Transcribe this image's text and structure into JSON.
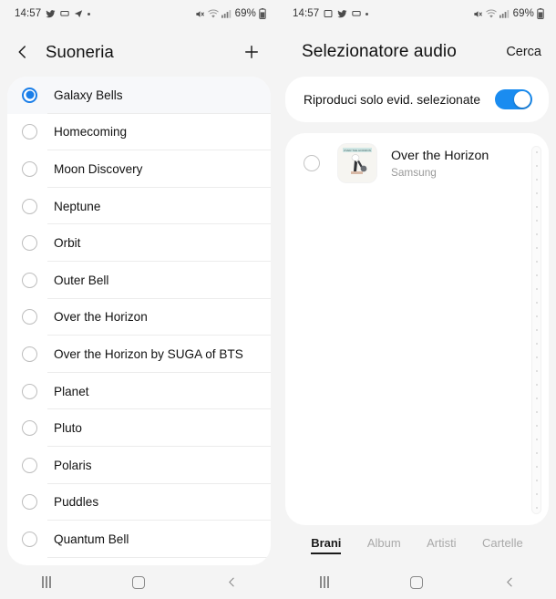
{
  "left": {
    "statusbar": {
      "time": "14:57",
      "left_icons": [
        "twitter-icon",
        "message-icon",
        "telegram-icon",
        "dot-icon"
      ],
      "right_icons": [
        "mute-icon",
        "wifi-icon",
        "signal-icon",
        "battery-icon"
      ],
      "battery_percent": "69%"
    },
    "header": {
      "back_icon": "chevron-left-icon",
      "title": "Suoneria",
      "add_icon": "plus-icon"
    },
    "ringtones": [
      {
        "label": "Galaxy Bells",
        "selected": true
      },
      {
        "label": "Homecoming",
        "selected": false
      },
      {
        "label": "Moon Discovery",
        "selected": false
      },
      {
        "label": "Neptune",
        "selected": false
      },
      {
        "label": "Orbit",
        "selected": false
      },
      {
        "label": "Outer Bell",
        "selected": false
      },
      {
        "label": "Over the Horizon",
        "selected": false
      },
      {
        "label": "Over the Horizon by SUGA of BTS",
        "selected": false
      },
      {
        "label": "Planet",
        "selected": false
      },
      {
        "label": "Pluto",
        "selected": false
      },
      {
        "label": "Polaris",
        "selected": false
      },
      {
        "label": "Puddles",
        "selected": false
      },
      {
        "label": "Quantum Bell",
        "selected": false
      }
    ],
    "navbar": {
      "recents": "recents-icon",
      "home": "home-icon",
      "back": "back-icon"
    }
  },
  "right": {
    "statusbar": {
      "time": "14:57",
      "left_icons": [
        "gallery-icon",
        "twitter-icon",
        "message-icon",
        "dot-icon"
      ],
      "right_icons": [
        "mute-icon",
        "wifi-icon",
        "signal-icon",
        "battery-icon"
      ],
      "battery_percent": "69%"
    },
    "header": {
      "title": "Selezionatore audio",
      "action_label": "Cerca"
    },
    "toggle": {
      "label": "Riproduci solo evid. selezionate",
      "enabled": true,
      "accent_color": "#1a8cf0"
    },
    "songs": [
      {
        "title": "Over the Horizon",
        "artist": "Samsung",
        "selected": false,
        "artwork": "over-the-horizon-album-art"
      }
    ],
    "tabs": [
      {
        "label": "Brani",
        "active": true
      },
      {
        "label": "Album",
        "active": false
      },
      {
        "label": "Artisti",
        "active": false
      },
      {
        "label": "Cartelle",
        "active": false
      }
    ],
    "navbar": {
      "recents": "recents-icon",
      "home": "home-icon",
      "back": "back-icon"
    }
  },
  "theme": {
    "page_background": "#f4f4f4",
    "card_background": "#ffffff",
    "accent": "#1a7ee8",
    "text_primary": "#121212",
    "text_secondary": "#9a9a9a"
  }
}
